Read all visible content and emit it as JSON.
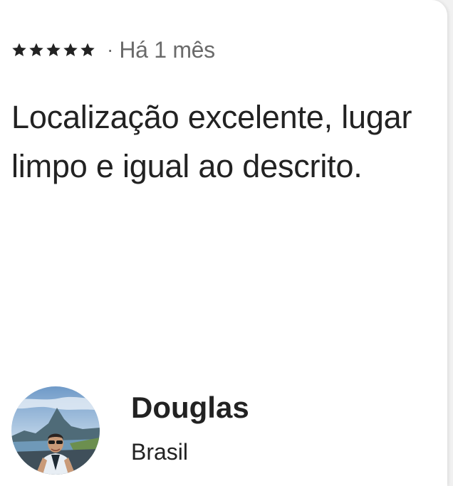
{
  "review": {
    "rating": 5,
    "rating_max": 5,
    "separator": "·",
    "time_ago": "Há 1 mês",
    "text": "Localização excelente, lugar limpo e igual ao descrito.",
    "reviewer": {
      "name": "Douglas",
      "country": "Brasil",
      "avatar_icon": "user-avatar-photo"
    }
  },
  "colors": {
    "text_primary": "#222222",
    "text_secondary": "#6a6a6a",
    "star": "#222222",
    "background": "#ffffff"
  }
}
